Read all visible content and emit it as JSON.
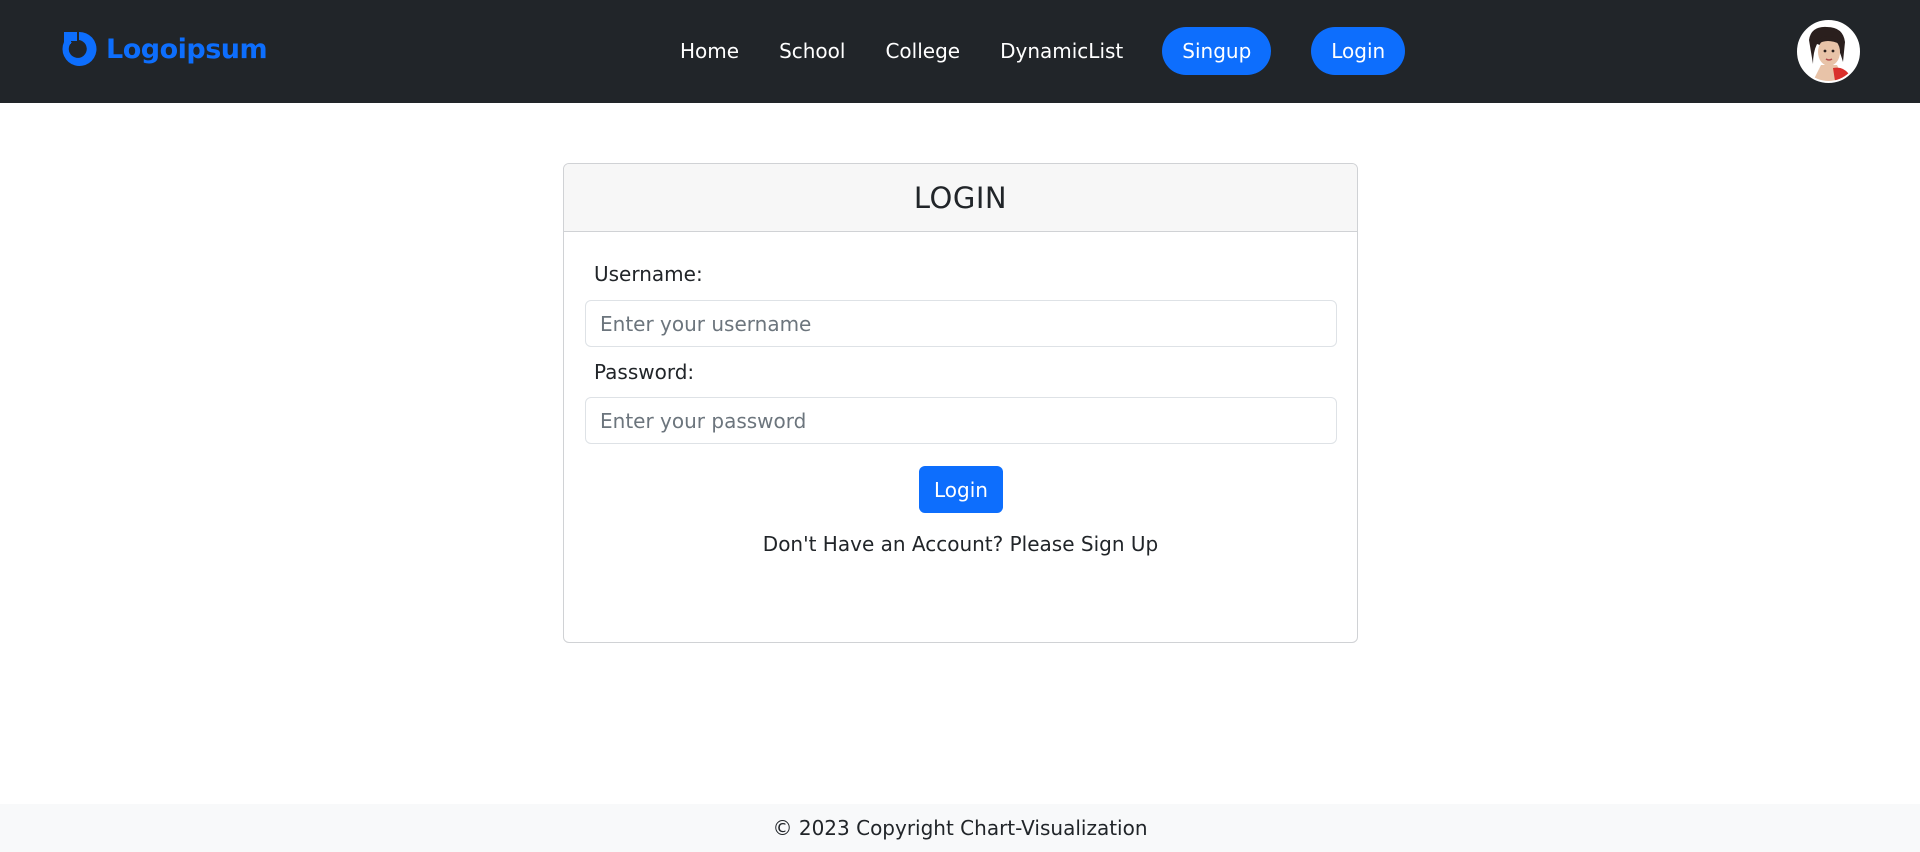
{
  "navbar": {
    "brand": {
      "name": "Logoipsum",
      "icon": "logo-icon",
      "color": "#0d6efd"
    },
    "links": [
      "Home",
      "School",
      "College",
      "DynamicList"
    ],
    "signup_label": "Singup",
    "login_label": "Login",
    "avatar_icon": "user-avatar-icon",
    "background": "#212529",
    "accent": "#0d6efd"
  },
  "login_card": {
    "title": "LOGIN",
    "username_label": "Username:",
    "username_placeholder": "Enter your username",
    "username_value": "",
    "password_label": "Password:",
    "password_placeholder": "Enter your password",
    "password_value": "",
    "submit_label": "Login",
    "signup_prompt": "Don't Have an Account? Please Sign Up"
  },
  "footer": {
    "text": "© 2023 Copyright Chart-Visualization"
  }
}
